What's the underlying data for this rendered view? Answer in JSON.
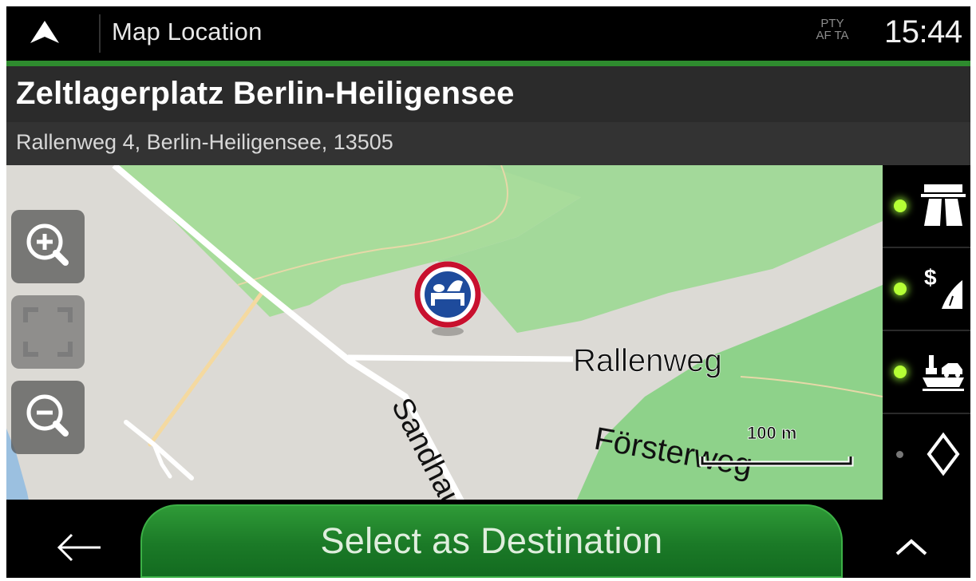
{
  "topbar": {
    "title": "Map Location",
    "indicator_top": "PTY",
    "indicator_bottom": "AF TA",
    "clock": "15:44"
  },
  "place": {
    "name": "Zeltlagerplatz Berlin-Heiligensee",
    "address": "Rallenweg 4, Berlin-Heiligensee, 13505"
  },
  "map": {
    "street_labels": {
      "rallenweg": "Rallenweg",
      "sandhausener": "Sandhau",
      "foersterweg": "Försterweg"
    },
    "scale_label": "100 m",
    "poi_icon": "campsite-icon",
    "colors": {
      "land": "#dcdad5",
      "forest": "#a8dc9b",
      "park": "#8ed28a",
      "water": "#9bc0e0",
      "road_major": "#ffffff",
      "road_minor": "#f4d9a0"
    }
  },
  "side_panel": {
    "filters": [
      {
        "icon": "motorway-icon",
        "led": "on"
      },
      {
        "icon": "toll-road-icon",
        "led": "on"
      },
      {
        "icon": "ferry-icon",
        "led": "on"
      },
      {
        "icon": "unpaved-road-icon",
        "led": "off"
      }
    ]
  },
  "bottom": {
    "back_icon": "back-arrow-icon",
    "primary_label": "Select as Destination",
    "more_icon": "chevron-up-icon",
    "accent": "#2e8b2e"
  }
}
